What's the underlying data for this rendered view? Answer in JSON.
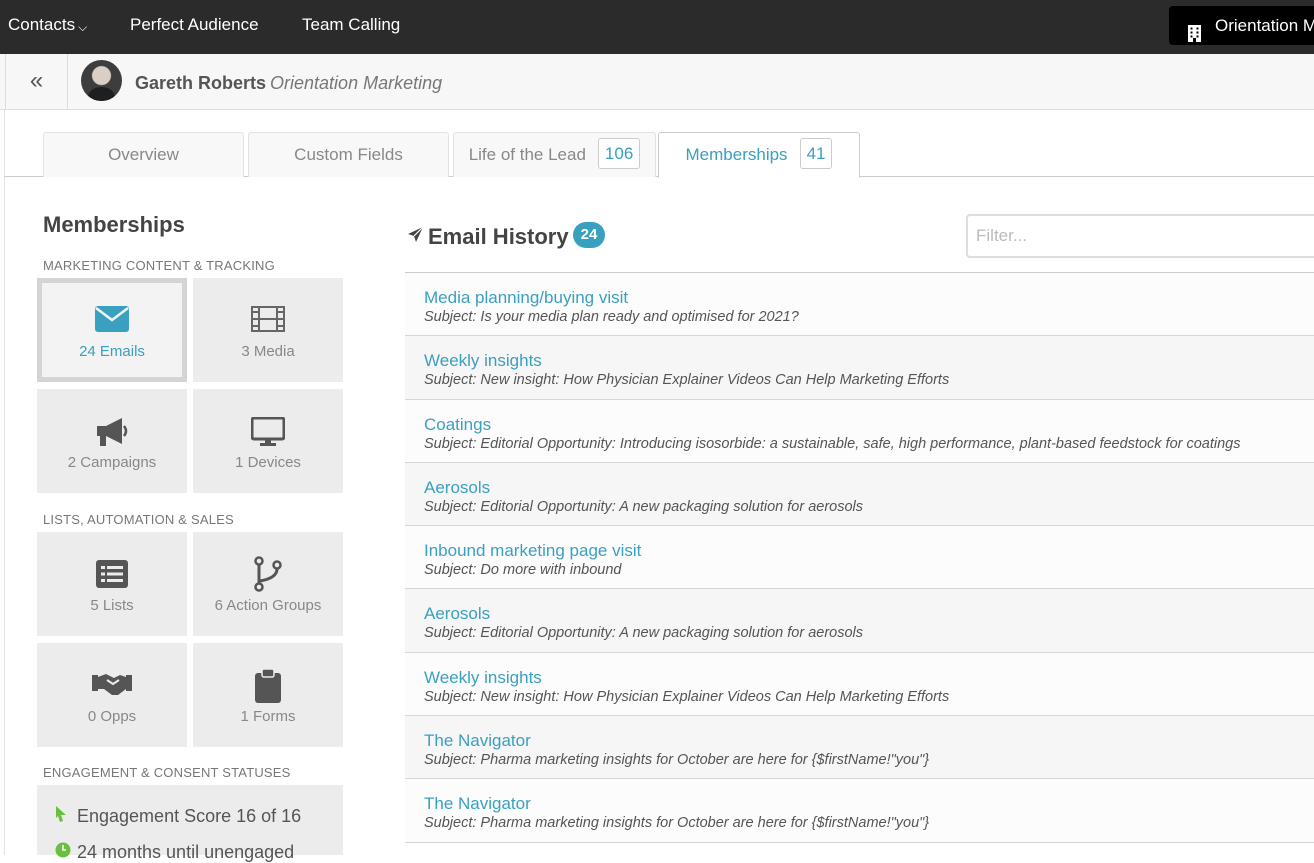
{
  "topnav": {
    "items": [
      {
        "label": "Contacts"
      },
      {
        "label": "Perfect Audience"
      },
      {
        "label": "Team Calling"
      }
    ],
    "org_button": "Orientation M"
  },
  "contact": {
    "name": "Gareth Roberts",
    "company": "Orientation Marketing"
  },
  "tabs": [
    {
      "label": "Overview",
      "count": null
    },
    {
      "label": "Custom Fields",
      "count": null
    },
    {
      "label": "Life of the Lead",
      "count": "106"
    },
    {
      "label": "Memberships",
      "count": "41",
      "active": true
    }
  ],
  "memberships": {
    "title": "Memberships",
    "sections": [
      {
        "label": "MARKETING CONTENT & TRACKING",
        "tiles": [
          {
            "label": "24 Emails",
            "icon": "envelope-icon",
            "selected": true
          },
          {
            "label": "3 Media",
            "icon": "film-icon"
          },
          {
            "label": "2 Campaigns",
            "icon": "megaphone-icon"
          },
          {
            "label": "1 Devices",
            "icon": "monitor-icon"
          }
        ]
      },
      {
        "label": "LISTS, AUTOMATION & SALES",
        "tiles": [
          {
            "label": "5 Lists",
            "icon": "list-icon"
          },
          {
            "label": "6 Action Groups",
            "icon": "branch-icon"
          },
          {
            "label": "0 Opps",
            "icon": "handshake-icon"
          },
          {
            "label": "1 Forms",
            "icon": "clipboard-icon"
          }
        ]
      },
      {
        "label": "ENGAGEMENT & CONSENT STATUSES",
        "items": [
          {
            "label": "Engagement Score 16 of 16",
            "icon": "cursor-icon"
          },
          {
            "label": "24 months until unengaged",
            "icon": "clock-icon"
          }
        ]
      }
    ]
  },
  "email_history": {
    "title": "Email History",
    "count": "24",
    "filter_placeholder": "Filter...",
    "rows": [
      {
        "name": "Media planning/buying visit",
        "subject": "Subject: Is your media plan ready and optimised for 2021?"
      },
      {
        "name": "Weekly insights",
        "subject": "Subject: New insight: How Physician Explainer Videos Can Help Marketing Efforts"
      },
      {
        "name": "Coatings",
        "subject": "Subject: Editorial Opportunity: Introducing isosorbide: a sustainable, safe, high performance, plant-based feedstock for coatings"
      },
      {
        "name": "Aerosols",
        "subject": "Subject: Editorial Opportunity: A new packaging solution for aerosols"
      },
      {
        "name": "Inbound marketing page visit",
        "subject": "Subject: Do more with inbound"
      },
      {
        "name": "Aerosols",
        "subject": "Subject: Editorial Opportunity: A new packaging solution for aerosols"
      },
      {
        "name": "Weekly insights",
        "subject": "Subject: New insight: How Physician Explainer Videos Can Help Marketing Efforts"
      },
      {
        "name": "The Navigator",
        "subject": "Subject: Pharma marketing insights for October are here for {$firstName!\"you\"}"
      },
      {
        "name": "The Navigator",
        "subject": "Subject: Pharma marketing insights for October are here for {$firstName!\"you\"}"
      }
    ]
  },
  "colors": {
    "accent": "#3aa0c0",
    "topnav_bg": "#2b2b2b",
    "tile_bg": "#ececec",
    "engagement_green": "#6abf3f"
  }
}
